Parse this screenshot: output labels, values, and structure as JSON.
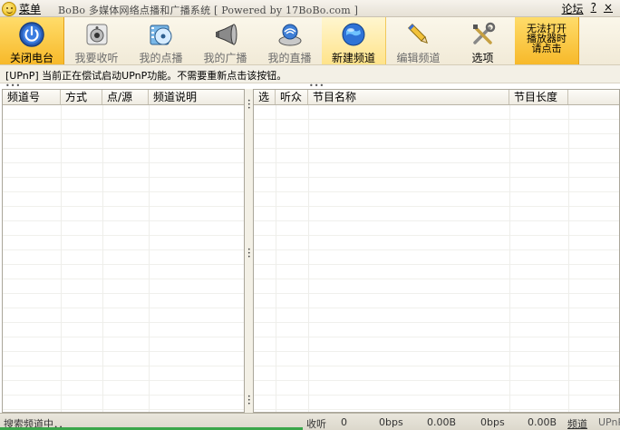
{
  "titlebar": {
    "menu_label": "菜单",
    "title": "BoBo 多媒体网络点播和广播系统 [ Powered by 17BoBo.com ]",
    "forum": "论坛",
    "help": "?",
    "close": "×"
  },
  "toolbar": {
    "buttons": [
      {
        "label": "关闭电台",
        "icon": "power-icon"
      },
      {
        "label": "我要收听",
        "icon": "speaker-box-icon"
      },
      {
        "label": "我的点播",
        "icon": "film-disc-icon"
      },
      {
        "label": "我的广播",
        "icon": "megaphone-icon"
      },
      {
        "label": "我的直播",
        "icon": "broadcast-dish-icon"
      },
      {
        "label": "新建频道",
        "icon": "globe-icon"
      },
      {
        "label": "编辑频道",
        "icon": "pencil-icon"
      },
      {
        "label": "选项",
        "icon": "tools-icon"
      },
      {
        "label": "无法打开播放器时请点击",
        "line1": "无法打开",
        "line2": "播放器时",
        "line3": "请点击"
      }
    ]
  },
  "info_line": "[UPnP]  当前正在偿试启动UPnP功能。不需要重新点击该按钮。",
  "left_table": {
    "columns": [
      "频道号",
      "方式",
      "点/源",
      "频道说明"
    ]
  },
  "right_table": {
    "columns": [
      "选",
      "听众",
      "节目名称",
      "节目长度"
    ]
  },
  "status": {
    "search": "搜索频道中．．",
    "listen_label": "收听",
    "listen_count": "0",
    "rate1": "0bps",
    "bytes1": "0.00B",
    "rate2": "0bps",
    "bytes2": "0.00B",
    "channel_label": "频道",
    "upnp": "UPnP"
  },
  "colors": {
    "active_button": "#f7b92a",
    "highlight_button": "#ffe38a",
    "progress": "#3aa64a"
  }
}
